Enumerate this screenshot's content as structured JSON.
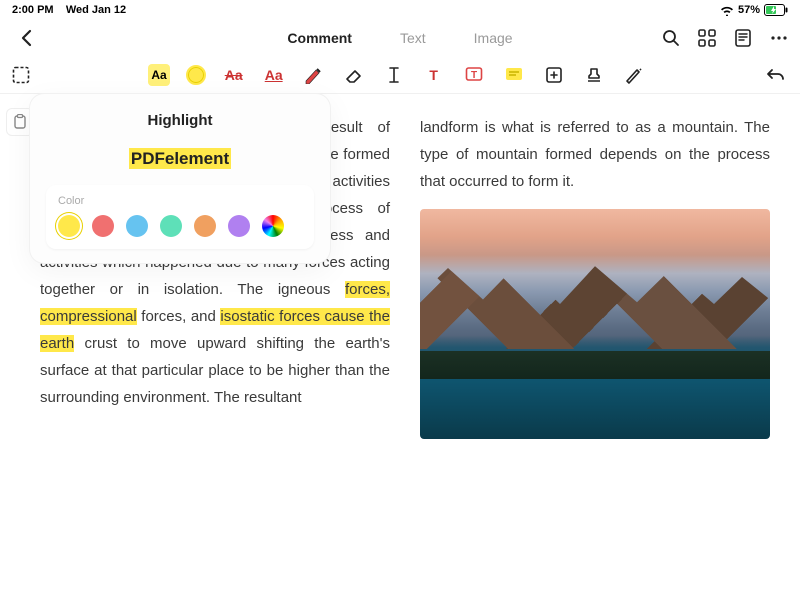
{
  "status": {
    "time": "2:00 PM",
    "date": "Wed Jan 12",
    "battery": "57%",
    "wifi": "wifi",
    "charging": true
  },
  "tabs": {
    "comment": "Comment",
    "text": "Text",
    "image": "Image"
  },
  "toolbar": {
    "highlight_label": "Aa"
  },
  "popover": {
    "title": "Highlight",
    "sample": "PDFelement",
    "color_label": "Color",
    "swatches": [
      "#ffe84a",
      "#f07070",
      "#66c3f0",
      "#5ee0b8",
      "#f0a060",
      "#b080f0"
    ]
  },
  "doc": {
    "left_pre": "Mountains are the most prominent result of geological processes of the nature. They are formed due to many gentle and even intense activities known as tectonic activities. The process of mountain formation involves many process and activities which happened due to many forces acting together or in isolation. The igneous ",
    "hl1": "forces, compressional",
    "left_mid": " forces, and ",
    "hl2": "isostatic forces cause the earth",
    "left_post": " crust to move upward shifting the earth's surface at that particular place to be higher than the surrounding environment. The resultant",
    "right": "landform is what is referred to as a mountain. The type of mountain formed depends on the process that occurred to form it."
  }
}
